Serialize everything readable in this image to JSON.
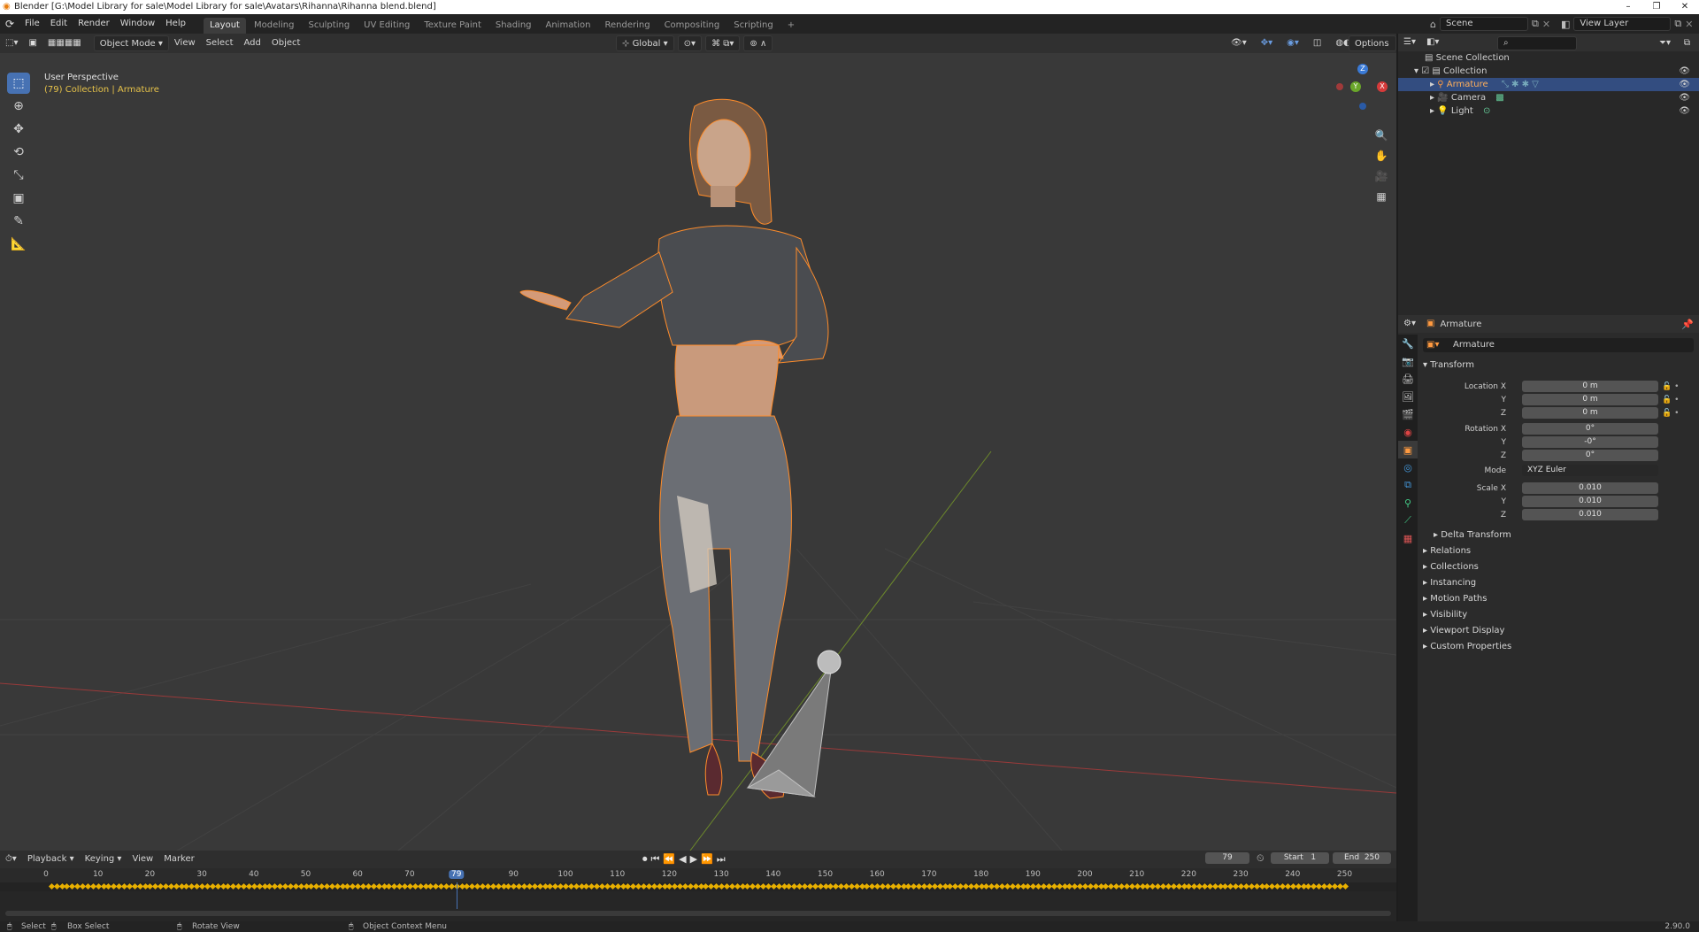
{
  "title_bar": {
    "text": "Blender [G:\\Model Library for sale\\Model Library for sale\\Avatars\\Rihanna\\Rihanna blend.blend]",
    "minimize": "–",
    "maximize": "❐",
    "close": "✕"
  },
  "menu": [
    "File",
    "Edit",
    "Render",
    "Window",
    "Help"
  ],
  "workspaces": [
    "Layout",
    "Modeling",
    "Sculpting",
    "UV Editing",
    "Texture Paint",
    "Shading",
    "Animation",
    "Rendering",
    "Compositing",
    "Scripting"
  ],
  "add_workspace": "+",
  "scene": {
    "name": "Scene",
    "view_layer": "View Layer"
  },
  "viewport_header": {
    "mode": "Object Mode",
    "menus": [
      "View",
      "Select",
      "Add",
      "Object"
    ],
    "transform_orientation": "Global",
    "options": "Options"
  },
  "viewport": {
    "perspective": "User Perspective",
    "context": "(79) Collection | Armature",
    "gizmo": {
      "x": "X",
      "y": "Y",
      "z": "Z"
    }
  },
  "outliner": {
    "search_placeholder": "",
    "items": [
      {
        "label": "Scene Collection"
      },
      {
        "label": "Collection"
      },
      {
        "label": "Armature"
      },
      {
        "label": "Camera"
      },
      {
        "label": "Light"
      }
    ]
  },
  "properties": {
    "header_object": "Armature",
    "object_name": "Armature",
    "transform_title": "Transform",
    "location": {
      "label": "Location X",
      "x": "0 m",
      "y": "0 m",
      "z": "0 m"
    },
    "rotation": {
      "label": "Rotation X",
      "x": "0°",
      "y": "-0°",
      "z": "0°"
    },
    "mode": {
      "label": "Mode",
      "value": "XYZ Euler"
    },
    "scale": {
      "label": "Scale X",
      "x": "0.010",
      "y": "0.010",
      "z": "0.010"
    },
    "axis_y": "Y",
    "axis_z": "Z",
    "delta_transform": "Delta Transform",
    "panels": [
      "Relations",
      "Collections",
      "Instancing",
      "Motion Paths",
      "Visibility",
      "Viewport Display",
      "Custom Properties"
    ]
  },
  "timeline": {
    "menus": [
      "Playback",
      "Keying",
      "View",
      "Marker"
    ],
    "current_frame": "79",
    "start_label": "Start",
    "start": "1",
    "end_label": "End",
    "end": "250",
    "ticks": [
      "0",
      "10",
      "20",
      "30",
      "40",
      "50",
      "60",
      "70",
      "79",
      "90",
      "100",
      "110",
      "120",
      "130",
      "140",
      "150",
      "160",
      "170",
      "180",
      "190",
      "200",
      "210",
      "220",
      "230",
      "240",
      "250"
    ]
  },
  "status_bar": {
    "select": "Select",
    "box_select": "Box Select",
    "rotate_view": "Rotate View",
    "context_menu": "Object Context Menu",
    "version": "2.90.0"
  },
  "colors": {
    "accent": "#4772b3",
    "selection_outline": "#ff8c2a",
    "grid_bg": "#393939",
    "current_frame": "#4772b3",
    "keyframe": "#e8b000"
  }
}
